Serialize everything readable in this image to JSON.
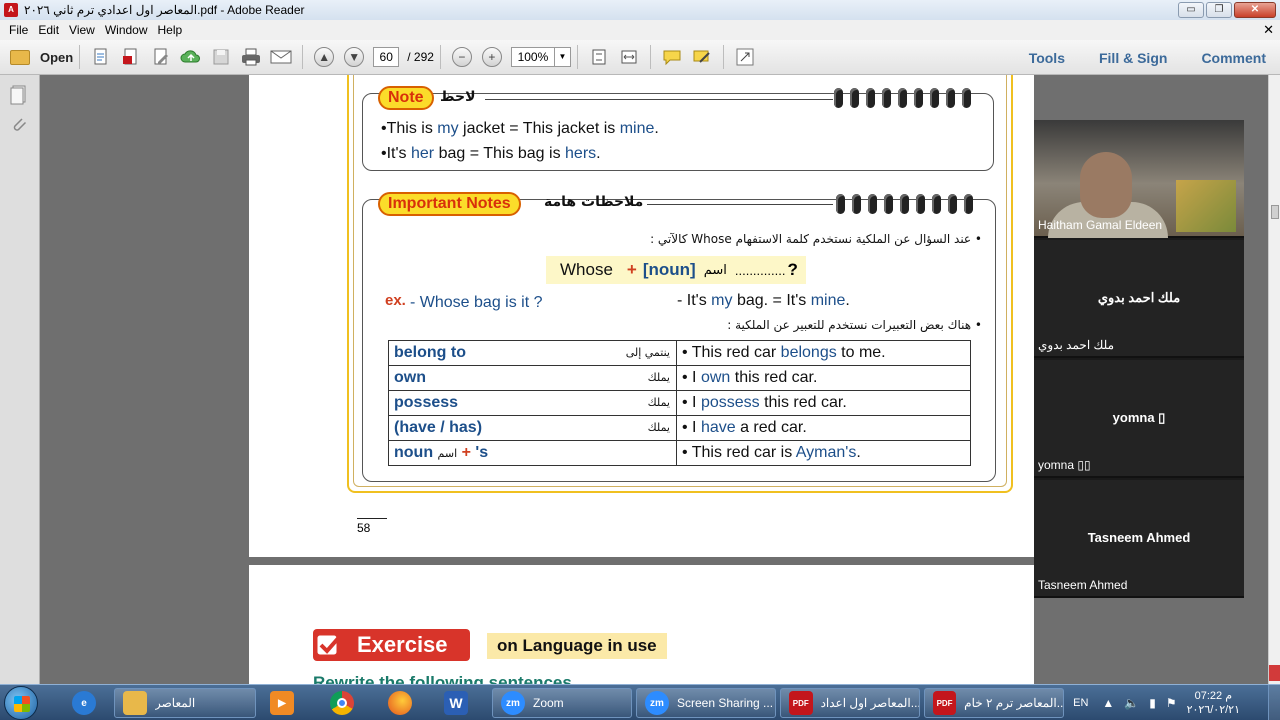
{
  "window": {
    "title": "المعاصر اول اعدادي ترم ثاني ٢٠٢٦.pdf - Adobe Reader",
    "app_icon": "pdf-icon",
    "buttons": {
      "minimize": "▭",
      "maximize": "❐",
      "close": "✕"
    }
  },
  "menu": {
    "items": [
      "File",
      "Edit",
      "View",
      "Window",
      "Help"
    ],
    "close_glyph": "✕"
  },
  "toolbar": {
    "open_label": "Open",
    "page_current": "60",
    "page_total": "/ 292",
    "zoom": "100%",
    "right_links": [
      "Tools",
      "Fill & Sign",
      "Comment"
    ]
  },
  "document": {
    "note": {
      "badge": "Note",
      "arabic_label": "لاحظ",
      "lines": [
        {
          "bullet": "•",
          "a": "This is ",
          "b": "my",
          "c": " jacket = This jacket is ",
          "d": "mine",
          "e": "."
        },
        {
          "bullet": "•",
          "a": "It's ",
          "b": "her",
          "c": " bag = This bag is ",
          "d": "hers",
          "e": "."
        }
      ]
    },
    "important": {
      "badge": "Important Notes",
      "arabic_label": "ملاحظات هامة",
      "ask_line": "• عند السؤال عن الملكية نستخدم كلمة الاستفهام Whose كالآتي :",
      "formula": {
        "whose": "Whose",
        "plus": "+",
        "noun": "[noun]",
        "ism": "اسم",
        "dots": "..............",
        "q": "?"
      },
      "ex_label": "ex.",
      "ex_question": "- Whose bag is it ?",
      "ex_answer_a": "- It's ",
      "ex_answer_b": "my",
      "ex_answer_c": " bag. = It's ",
      "ex_answer_d": "mine",
      "ex_answer_e": ".",
      "expr_line": "• هناك بعض التعبيرات نستخدم للتعبير عن الملكية :",
      "rows": [
        {
          "term": "belong to",
          "ar": "ينتمي إلى",
          "example_a": "• This red car ",
          "example_b": "belongs",
          "example_c": " to me."
        },
        {
          "term": "own",
          "ar": "يملك",
          "example_a": "• I ",
          "example_b": "own",
          "example_c": " this red car."
        },
        {
          "term": "possess",
          "ar": "يملك",
          "example_a": "• I ",
          "example_b": "possess",
          "example_c": " this red car."
        },
        {
          "term": "(have / has)",
          "ar": "يملك",
          "example_a": "• I ",
          "example_b": "have",
          "example_c": " a red car."
        },
        {
          "term": "noun",
          "ism": "اسم",
          "plus": "+",
          "s": "'s",
          "ar": "",
          "example_a": "• This red car is ",
          "example_b": "Ayman's",
          "example_c": "."
        }
      ]
    },
    "page_number": "58",
    "page2": {
      "exercise": "Exercise",
      "subtitle": "on Language in use",
      "rewrite": "Rewrite the following sentences"
    }
  },
  "zoom": {
    "participants": [
      {
        "center": "",
        "corner": "Haitham Gamal Eldeen",
        "video": true
      },
      {
        "center": "ملك احمد بدوي",
        "corner": "ملك احمد بدوي",
        "video": false
      },
      {
        "center": "yomna ▯",
        "corner": "yomna ▯▯",
        "video": false
      },
      {
        "center": "Tasneem Ahmed",
        "corner": "Tasneem Ahmed",
        "video": false
      }
    ]
  },
  "taskbar": {
    "apps": [
      {
        "label": "المعاصر",
        "icon": "folder-icon"
      },
      {
        "label": "",
        "icon": "media-player-icon"
      },
      {
        "label": "",
        "icon": "chrome-icon"
      },
      {
        "label": "",
        "icon": "firefox-icon"
      },
      {
        "label": "",
        "icon": "word-icon"
      },
      {
        "label": "Zoom",
        "icon": "zoom-icon"
      },
      {
        "label": "Screen Sharing ...",
        "icon": "zoom-icon"
      },
      {
        "label": "المعاصر اول اعداد...",
        "icon": "pdf-icon"
      },
      {
        "label": "المعاصر ترم ٢ خام...",
        "icon": "pdf-icon"
      }
    ],
    "language": "EN",
    "time": "07:22 م",
    "date": "٢٠٢٦/٠٢/٢١"
  },
  "colors": {
    "accent_blue": "#1d4f8a",
    "note_yellow": "#fbdc2a",
    "note_red": "#d8300a",
    "exercise_red": "#d8342a",
    "rewrite_teal": "#1a7a6a",
    "toolbar_link": "#3c6a9a"
  }
}
